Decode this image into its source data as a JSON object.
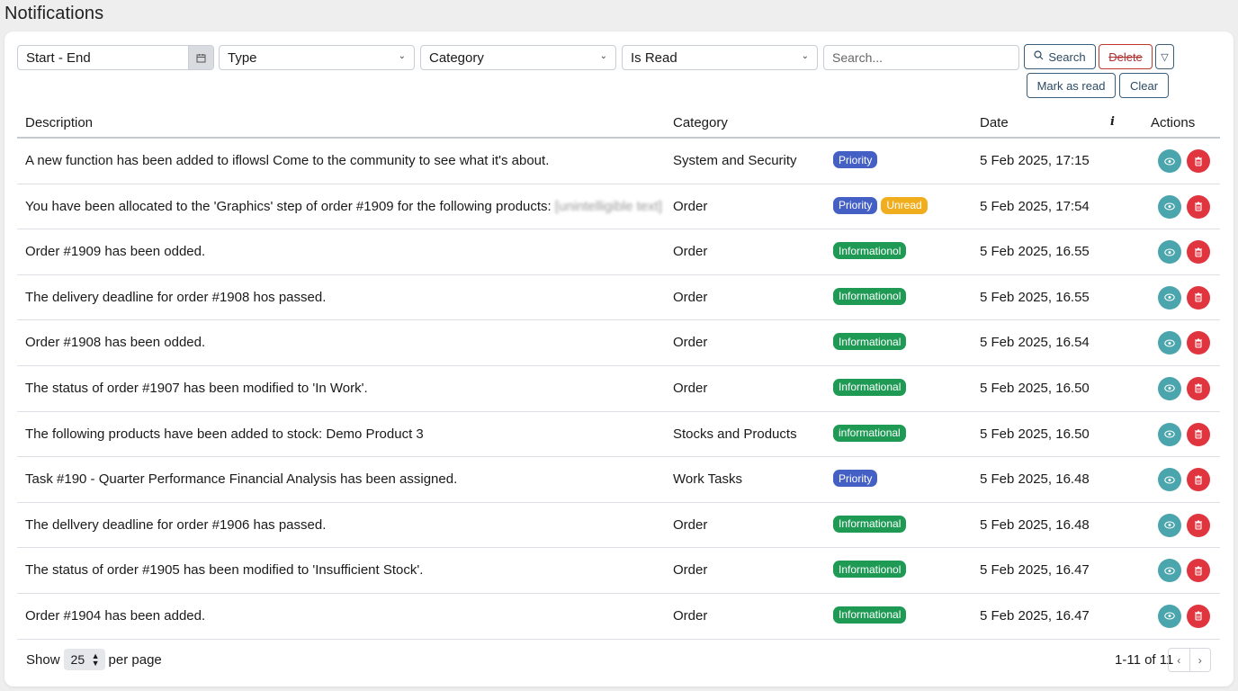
{
  "page": {
    "title": "Notifications"
  },
  "filters": {
    "date_range": "Start - End",
    "type": "Type",
    "category": "Category",
    "is_read": "Is Read",
    "search_placeholder": "Search..."
  },
  "toolbar": {
    "search": "Search",
    "delete": "Delete",
    "mark_as_read": "Mark as read",
    "clear": "Clear"
  },
  "table": {
    "columns": {
      "description": "Description",
      "category": "Category",
      "date": "Date",
      "info": "i",
      "actions": "Actions"
    },
    "rows": [
      {
        "description": "A new function has been added to iflowsl Come to the community to see what it's about.",
        "blurred": "",
        "category": "System and Security",
        "badges": [
          {
            "label": "Priority",
            "kind": "priority"
          }
        ],
        "date": "5 Feb 2025, 17:15"
      },
      {
        "description": "You have been allocated to the 'Graphics' step of order #1909 for the following products:",
        "blurred": "[unintelligible text]",
        "category": "Order",
        "badges": [
          {
            "label": "Priority",
            "kind": "priority"
          },
          {
            "label": "Unread",
            "kind": "unread"
          }
        ],
        "date": "5 Feb 2025, 17:54"
      },
      {
        "description": "Order #1909 has been odded.",
        "blurred": "",
        "category": "Order",
        "badges": [
          {
            "label": "Informationol",
            "kind": "info"
          }
        ],
        "date": "5 Feb 2025, 16.55"
      },
      {
        "description": "The delivery deadline for order #1908 hos passed.",
        "blurred": "",
        "category": "Order",
        "badges": [
          {
            "label": "Informationol",
            "kind": "info"
          }
        ],
        "date": "5 Feb 2025, 16.55"
      },
      {
        "description": "Order #1908 has been odded.",
        "blurred": "",
        "category": "Order",
        "badges": [
          {
            "label": "Informational",
            "kind": "info"
          }
        ],
        "date": "5 Feb 2025, 16.54"
      },
      {
        "description": "The status of order #1907 has been modified to 'In Work'.",
        "blurred": "",
        "category": "Order",
        "badges": [
          {
            "label": "Informational",
            "kind": "info"
          }
        ],
        "date": "5 Feb 2025, 16.50"
      },
      {
        "description": "The following products have been added to stock: Demo Product 3",
        "blurred": "",
        "category": "Stocks and Products",
        "badges": [
          {
            "label": "informational",
            "kind": "info"
          }
        ],
        "date": "5 Feb 2025, 16.50"
      },
      {
        "description": "Task #190 - Quarter Performance Financial Analysis has been assigned.",
        "blurred": "",
        "category": "Work Tasks",
        "badges": [
          {
            "label": "Priority",
            "kind": "priority"
          }
        ],
        "date": "5 Feb 2025, 16.48"
      },
      {
        "description": "The dellvery deadline for order #1906 has passed.",
        "blurred": "",
        "category": "Order",
        "badges": [
          {
            "label": "Informational",
            "kind": "info"
          }
        ],
        "date": "5 Feb 2025, 16.48"
      },
      {
        "description": "The status of order #1905 has been modified to 'Insufficient Stock'.",
        "blurred": "",
        "category": "Order",
        "badges": [
          {
            "label": "Informationol",
            "kind": "info"
          }
        ],
        "date": "5 Feb 2025, 16.47"
      },
      {
        "description": "Order #1904 has been added.",
        "blurred": "",
        "category": "Order",
        "badges": [
          {
            "label": "Informational",
            "kind": "info"
          }
        ],
        "date": "5 Feb 2025, 16.47"
      }
    ]
  },
  "footer": {
    "show": "Show",
    "per_page_value": "25",
    "per_page": "per page",
    "range": "1-11 of 11"
  },
  "icons": {
    "calendar": "calendar-icon",
    "chevron": "chevron-down-icon",
    "search": "search-icon",
    "filter": "filter-icon",
    "view": "eye-icon",
    "delete": "trash-icon"
  }
}
